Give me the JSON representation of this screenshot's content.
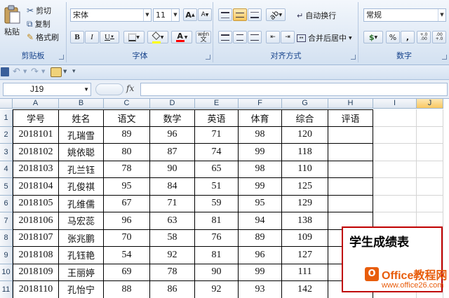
{
  "ribbon": {
    "clipboard": {
      "title": "剪贴板",
      "paste": "粘贴",
      "cut": "剪切",
      "copy": "复制",
      "format_painter": "格式刷"
    },
    "font": {
      "title": "字体",
      "font_name": "宋体",
      "font_size": "11",
      "grow": "A",
      "shrink": "A",
      "bold": "B",
      "italic": "I",
      "underline": "U",
      "font_color_glyph": "A",
      "wen": "wén",
      "highlight_color": "#ffff00",
      "font_color": "#ff0000"
    },
    "alignment": {
      "title": "对齐方式",
      "wrap_text": "自动换行",
      "merge_center": "合并后居中"
    },
    "number": {
      "title": "数字",
      "format": "常规",
      "percent": "%",
      "comma": ",",
      "currency_glyph": "$",
      "inc_decimal": "+.0 .00",
      "dec_decimal": ".00 +.0"
    }
  },
  "formula_bar": {
    "name_box": "J19",
    "fx": "fx",
    "formula": ""
  },
  "grid": {
    "columns": [
      "A",
      "B",
      "C",
      "D",
      "E",
      "F",
      "G",
      "H",
      "I",
      "J"
    ],
    "rows": [
      "1",
      "2",
      "3",
      "4",
      "5",
      "6",
      "7",
      "8",
      "9",
      "10",
      "11"
    ],
    "header": [
      "学号",
      "姓名",
      "语文",
      "数学",
      "英语",
      "体育",
      "综合",
      "评语"
    ],
    "data": [
      [
        "2018101",
        "孔瑞雪",
        "89",
        "96",
        "71",
        "98",
        "120"
      ],
      [
        "2018102",
        "姚依聪",
        "80",
        "87",
        "74",
        "99",
        "118"
      ],
      [
        "2018103",
        "孔兰钰",
        "78",
        "90",
        "65",
        "98",
        "110"
      ],
      [
        "2018104",
        "孔俊祺",
        "95",
        "84",
        "51",
        "99",
        "125"
      ],
      [
        "2018105",
        "孔维儒",
        "67",
        "71",
        "59",
        "95",
        "129"
      ],
      [
        "2018106",
        "马宏蕊",
        "96",
        "63",
        "81",
        "94",
        "138"
      ],
      [
        "2018107",
        "张兆鹏",
        "70",
        "58",
        "76",
        "89",
        "109"
      ],
      [
        "2018108",
        "孔钰艳",
        "54",
        "92",
        "81",
        "96",
        "127"
      ],
      [
        "2018109",
        "王丽婷",
        "69",
        "78",
        "90",
        "99",
        "111"
      ],
      [
        "2018110",
        "孔怡宁",
        "88",
        "86",
        "92",
        "93",
        "142"
      ]
    ]
  },
  "overlay": {
    "title": "学生成绩表"
  },
  "watermark": {
    "brand": "Office教程网",
    "url": "www.office26.com",
    "logo_glyph": "O"
  }
}
